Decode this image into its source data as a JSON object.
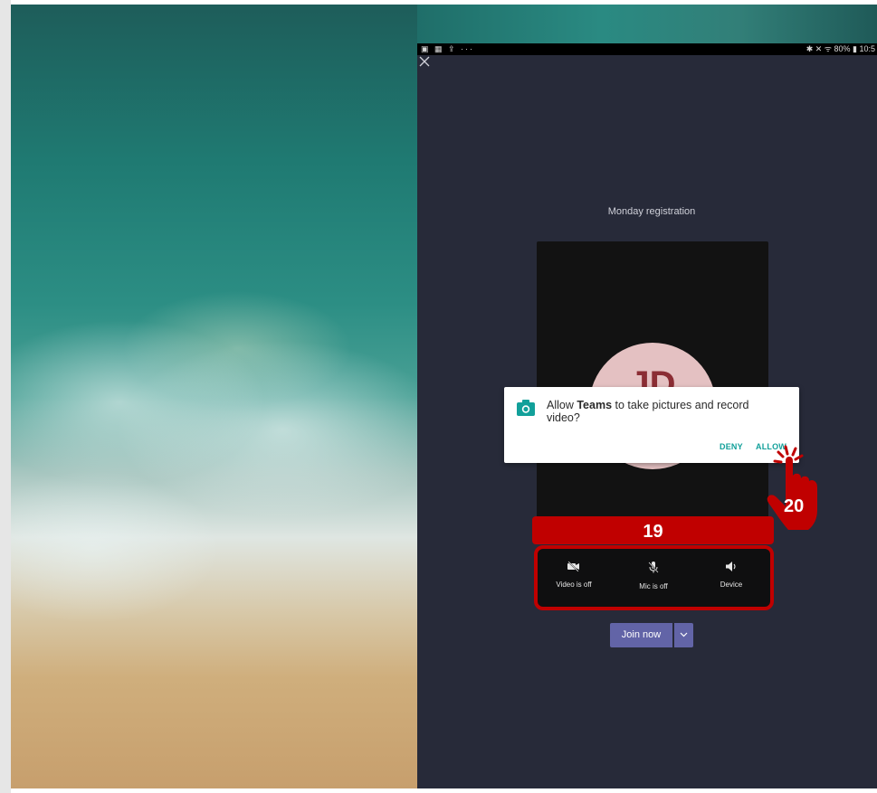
{
  "status_bar": {
    "left_icons": "▣ ▦ ⇪ ···",
    "right_text": "✱ ✕ ᯤ 80% ▮ 10:5"
  },
  "meeting": {
    "title": "Monday registration",
    "avatar_initials": "JD"
  },
  "permission_dialog": {
    "text_prefix": "Allow ",
    "app_name": "Teams",
    "text_suffix": " to take pictures and record video?",
    "deny_label": "DENY",
    "allow_label": "ALLOW",
    "icon": "camera-icon",
    "accent_color": "#12a09a"
  },
  "controls": {
    "video_label": "Video is off",
    "mic_label": "Mic is off",
    "device_label": "Device"
  },
  "join": {
    "label": "Join now"
  },
  "annotations": {
    "step_19": "19",
    "step_20": "20",
    "highlight_color": "#c00000"
  },
  "colors": {
    "tablet_background": "#272a39",
    "teams_purple": "#6264a7"
  }
}
